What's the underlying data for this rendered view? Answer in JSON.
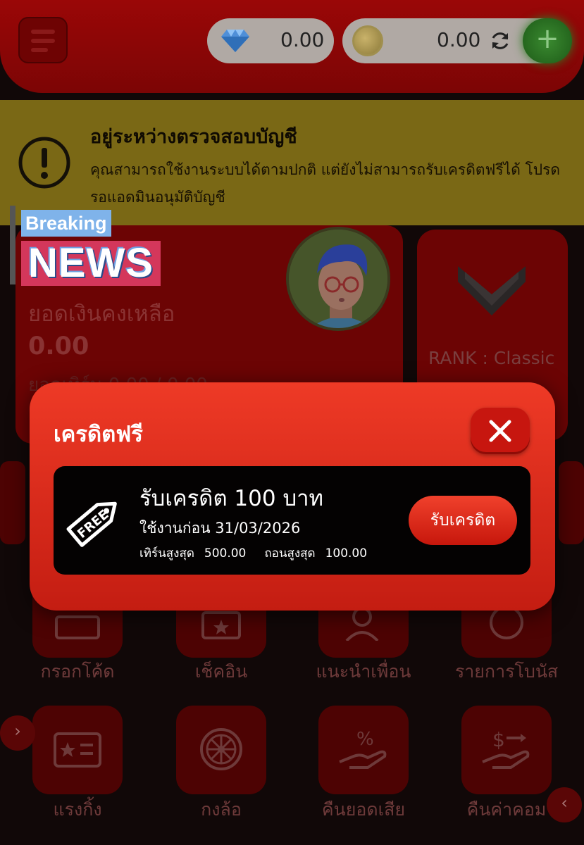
{
  "header": {
    "diamond_balance": "0.00",
    "coin_balance": "0.00",
    "add_label": "+"
  },
  "verification_banner": {
    "title": "อยู่ระหว่างตรวจสอบบัญชี",
    "message": "คุณสามารถใช้งานระบบได้ตามปกติ แต่ยังไม่สามารถรับเครดิตฟรีได้ โปรดรอแอดมินอนุมัติบัญชี"
  },
  "account_card": {
    "balance_label": "ยอดเงินคงเหลือ",
    "balance_value": "0.00",
    "turnover_text": "ยอดเทิร์น 0.00 / 0.00"
  },
  "rank_card": {
    "rank_text": "RANK : Classic"
  },
  "sticker": {
    "line1": "Breaking",
    "line2": "NEWS"
  },
  "menu_tiles": [
    {
      "label": "กรอกโค้ด",
      "icon": "ticket-icon"
    },
    {
      "label": "เช็คอิน",
      "icon": "star-calendar-icon"
    },
    {
      "label": "แนะนำเพื่อน",
      "icon": "add-user-icon"
    },
    {
      "label": "รายการโบนัส",
      "icon": "dollar-badge-icon"
    },
    {
      "label": "แรงกิ้ง",
      "icon": "star-card-icon"
    },
    {
      "label": "กงล้อ",
      "icon": "wheel-icon"
    },
    {
      "label": "คืนยอดเสีย",
      "icon": "percent-hand-icon"
    },
    {
      "label": "คืนค่าคอม",
      "icon": "dollar-hand-icon"
    }
  ],
  "free_credit_modal": {
    "title": "เครดิตฟรี",
    "tag_text": "FREE",
    "offer_title": "รับเครดิต 100 บาท",
    "valid_until": "ใช้งานก่อน 31/03/2026",
    "max_turnover_label": "เทิร์นสูงสุด",
    "max_turnover_value": "500.00",
    "max_withdraw_label": "ถอนสูงสุด",
    "max_withdraw_value": "100.00",
    "claim_label": "รับเครดิต"
  },
  "nav": {
    "right_arrow": "›",
    "left_arrow": "‹"
  },
  "colors": {
    "modal_red": "#e83423",
    "banner_yellow": "#7a6815",
    "add_green": "#2f7d23"
  }
}
